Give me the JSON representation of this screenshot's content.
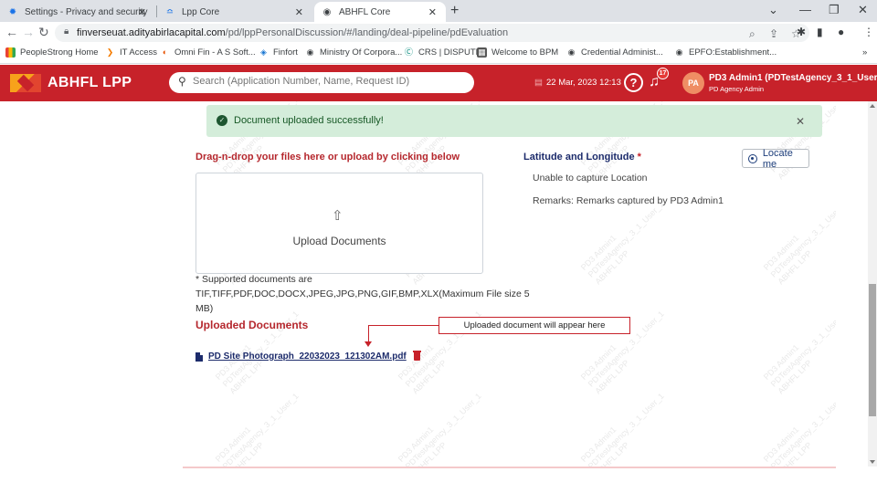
{
  "browser": {
    "tabs": [
      {
        "title": "Settings - Privacy and security",
        "icon": "gear-icon"
      },
      {
        "title": "Lpp Core",
        "icon": "lpp-icon"
      },
      {
        "title": "ABHFL Core",
        "icon": "globe-icon",
        "active": true
      }
    ],
    "url_host": "finverseuat.adityabirlacapital.com",
    "url_path": "/pd/lppPersonalDiscussion/#/landing/deal-pipeline/pdEvaluation",
    "bookmarks": [
      "PeopleStrong Home",
      "IT Access",
      "Omni Fin - A S Soft...",
      "Finfort",
      "Ministry Of Corpora...",
      "CRS | DISPUTE",
      "Welcome to BPM",
      "Credential Administ...",
      "EPFO:Establishment..."
    ]
  },
  "app": {
    "brand": "ABHFL LPP",
    "search_placeholder": "Search (Application Number, Name, Request ID)",
    "datetime": "22 Mar, 2023 12:13",
    "notification_count": "17",
    "avatar_initials": "PA",
    "user_name": "PD3 Admin1 (PDTestAgency_3_1_User_",
    "user_role": "PD Agency Admin",
    "brand_color": "#c7222a"
  },
  "main": {
    "alert_message": "Document uploaded successfully!",
    "dropzone_title": "Drag-n-drop your files here or upload by clicking below",
    "upload_label": "Upload Documents",
    "supported_docs": "* Supported documents are TIF,TIFF,PDF,DOC,DOCX,JPEG,JPG,PNG,GIF,BMP,XLX(Maximum File size 5 MB)",
    "latlong_title": "Latitude and Longitude",
    "latlong_required": "*",
    "locate_label": "Locate me",
    "location_status": "Unable to capture Location",
    "remarks": "Remarks: Remarks captured by PD3 Admin1",
    "uploaded_title": "Uploaded Documents",
    "annotation": "Uploaded document will appear here",
    "uploaded_file": "PD Site Photograph_22032023_121302AM.pdf"
  },
  "watermark": {
    "line1": "PD3 Admin1",
    "line2": "PDTestAgency_3_1_User_1",
    "line3": "ABHFL LPP"
  }
}
